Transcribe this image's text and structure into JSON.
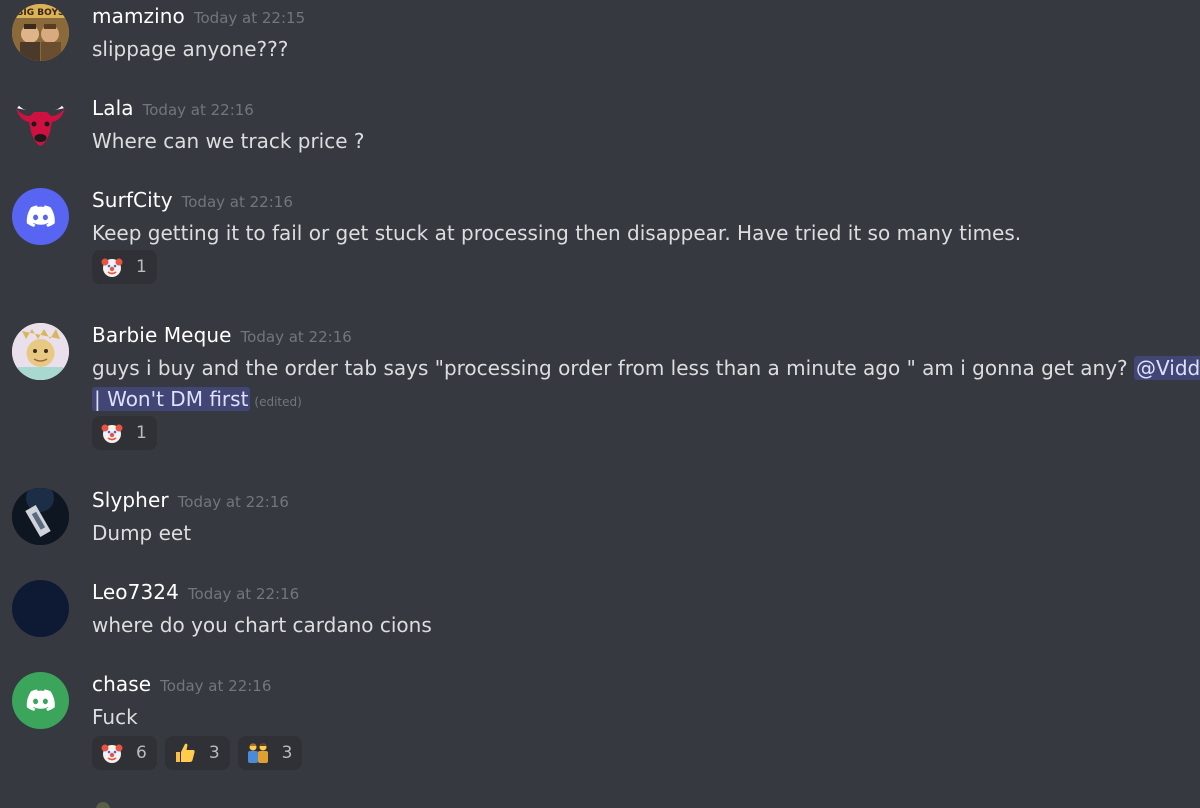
{
  "messages": [
    {
      "username": "mamzino",
      "timestamp": "Today at 22:15",
      "text": "slippage anyone???",
      "avatar": "big-boys-avatar",
      "avatar_label": "BIG BOYS"
    },
    {
      "username": "Lala",
      "timestamp": "Today at 22:16",
      "text": "Where can we track price ?",
      "avatar": "bull-logo-avatar"
    },
    {
      "username": "SurfCity",
      "timestamp": "Today at 22:16",
      "text": "Keep getting it to fail or get stuck at processing then disappear.  Have tried it so many times.",
      "avatar": "discord-default-avatar",
      "avatar_color": "#5865f2",
      "reactions": [
        {
          "emoji": "clown-emoji",
          "count": "1"
        }
      ]
    },
    {
      "username": "Barbie Meque",
      "timestamp": "Today at 22:16",
      "text_line1": "guys i buy and the order tab   says \"processing order from less than a minute ago \" am i gonna get any?",
      "mention_line1": "@Viddie",
      "mention_line2": "| Won't DM first",
      "edited": "(edited)",
      "avatar": "barbie-avatar",
      "reactions": [
        {
          "emoji": "clown-emoji",
          "count": "1"
        }
      ]
    },
    {
      "username": "Slypher",
      "timestamp": "Today at 22:16",
      "text": "Dump eet",
      "avatar": "slypher-avatar"
    },
    {
      "username": "Leo7324",
      "timestamp": "Today at 22:16",
      "text": "where do you chart cardano cions",
      "avatar": "dark-blue-avatar",
      "avatar_color": "#0e1a33"
    },
    {
      "username": "chase",
      "timestamp": "Today at 22:16",
      "text": "Fuck",
      "avatar": "discord-default-avatar",
      "avatar_color": "#3ba55c",
      "reactions": [
        {
          "emoji": "clown-emoji",
          "count": "6"
        },
        {
          "emoji": "thumbs-up-emoji",
          "count": "3"
        },
        {
          "emoji": "people-emoji",
          "count": "3"
        }
      ]
    }
  ]
}
